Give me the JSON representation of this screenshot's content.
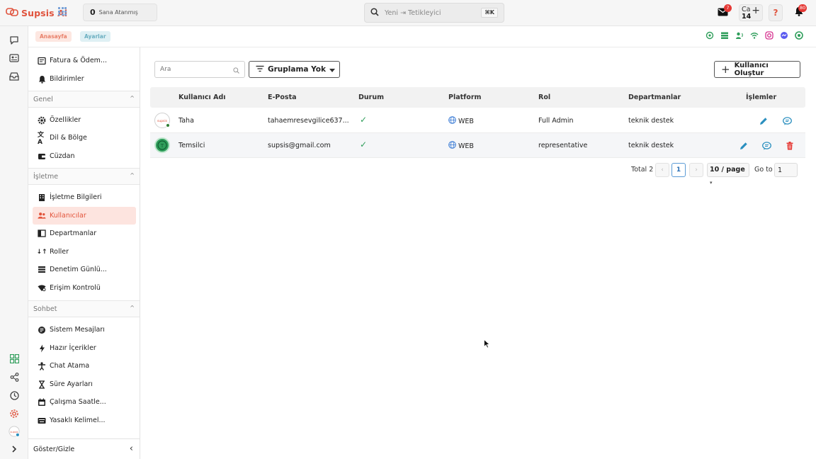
{
  "app": {
    "name": "Supsis Ai",
    "brand_color": "#e0533d"
  },
  "topbar": {
    "assigned_count": "0",
    "assigned_label": "Sana Atanmış",
    "search_placeholder": "Yeni ⇥ Tetikleyici",
    "search_shortcut": "⌘K",
    "mail_badge": "7",
    "calendar_label": "Ca",
    "calendar_day": "14",
    "help_label": "?",
    "notification_badge": "80"
  },
  "tabs": [
    {
      "label": "Anasayfa"
    },
    {
      "label": "Ayarlar"
    }
  ],
  "sidebar": {
    "top_items": [
      {
        "label": "Fatura & Ödem...",
        "icon": "invoice-icon"
      },
      {
        "label": "Bildirimler",
        "icon": "bell-icon"
      }
    ],
    "sections": [
      {
        "title": "Genel",
        "items": [
          {
            "label": "Özellikler",
            "icon": "gear-icon"
          },
          {
            "label": "Dil & Bölge",
            "icon": "translate-icon"
          },
          {
            "label": "Cüzdan",
            "icon": "wallet-icon"
          }
        ]
      },
      {
        "title": "İşletme",
        "items": [
          {
            "label": "İşletme Bilgileri",
            "icon": "building-icon"
          },
          {
            "label": "Kullanıcılar",
            "icon": "users-icon",
            "active": true
          },
          {
            "label": "Departmanlar",
            "icon": "department-icon"
          },
          {
            "label": "Roller",
            "icon": "roles-icon"
          },
          {
            "label": "Denetim Günlü...",
            "icon": "audit-log-icon"
          },
          {
            "label": "Erişim Kontrolü",
            "icon": "access-control-icon"
          }
        ]
      },
      {
        "title": "Sohbet",
        "items": [
          {
            "label": "Sistem Mesajları",
            "icon": "system-messages-icon"
          },
          {
            "label": "Hazır İçerikler",
            "icon": "bolt-icon"
          },
          {
            "label": "Chat Atama",
            "icon": "person-assign-icon"
          },
          {
            "label": "Süre Ayarları",
            "icon": "hourglass-icon"
          },
          {
            "label": "Çalışma Saatle...",
            "icon": "calendar-icon"
          },
          {
            "label": "Yasaklı Kelimel...",
            "icon": "keyboard-icon"
          }
        ]
      }
    ],
    "footer_label": "Göster/Gizle"
  },
  "main": {
    "search_placeholder": "Ara",
    "group_label": "Gruplama Yok",
    "create_label": "Kullanıcı Oluştur",
    "columns": [
      "Kullanıcı Adı",
      "E-Posta",
      "Durum",
      "Platform",
      "Rol",
      "Departmanlar",
      "İşlemler"
    ],
    "rows": [
      {
        "name": "Taha",
        "email": "tahaemresevgilice637...",
        "status": "✓",
        "platform": "WEB",
        "role": "Full Admin",
        "department": "teknik destek"
      },
      {
        "name": "Temsilci",
        "email": "supsis@gmail.com",
        "status": "✓",
        "platform": "WEB",
        "role": "representative",
        "department": "teknik destek"
      }
    ],
    "pagination": {
      "total": "Total 2",
      "prev": "‹",
      "current": "1",
      "next": "›",
      "page_size": "10 / page",
      "goto_label": "Go to",
      "goto_value": "1"
    }
  },
  "colors": {
    "accent": "#e0533d",
    "active_bg": "#fde4df",
    "success": "#2f9e5b",
    "edit_icon": "#2a8fbf",
    "delete_icon": "#e53935"
  }
}
